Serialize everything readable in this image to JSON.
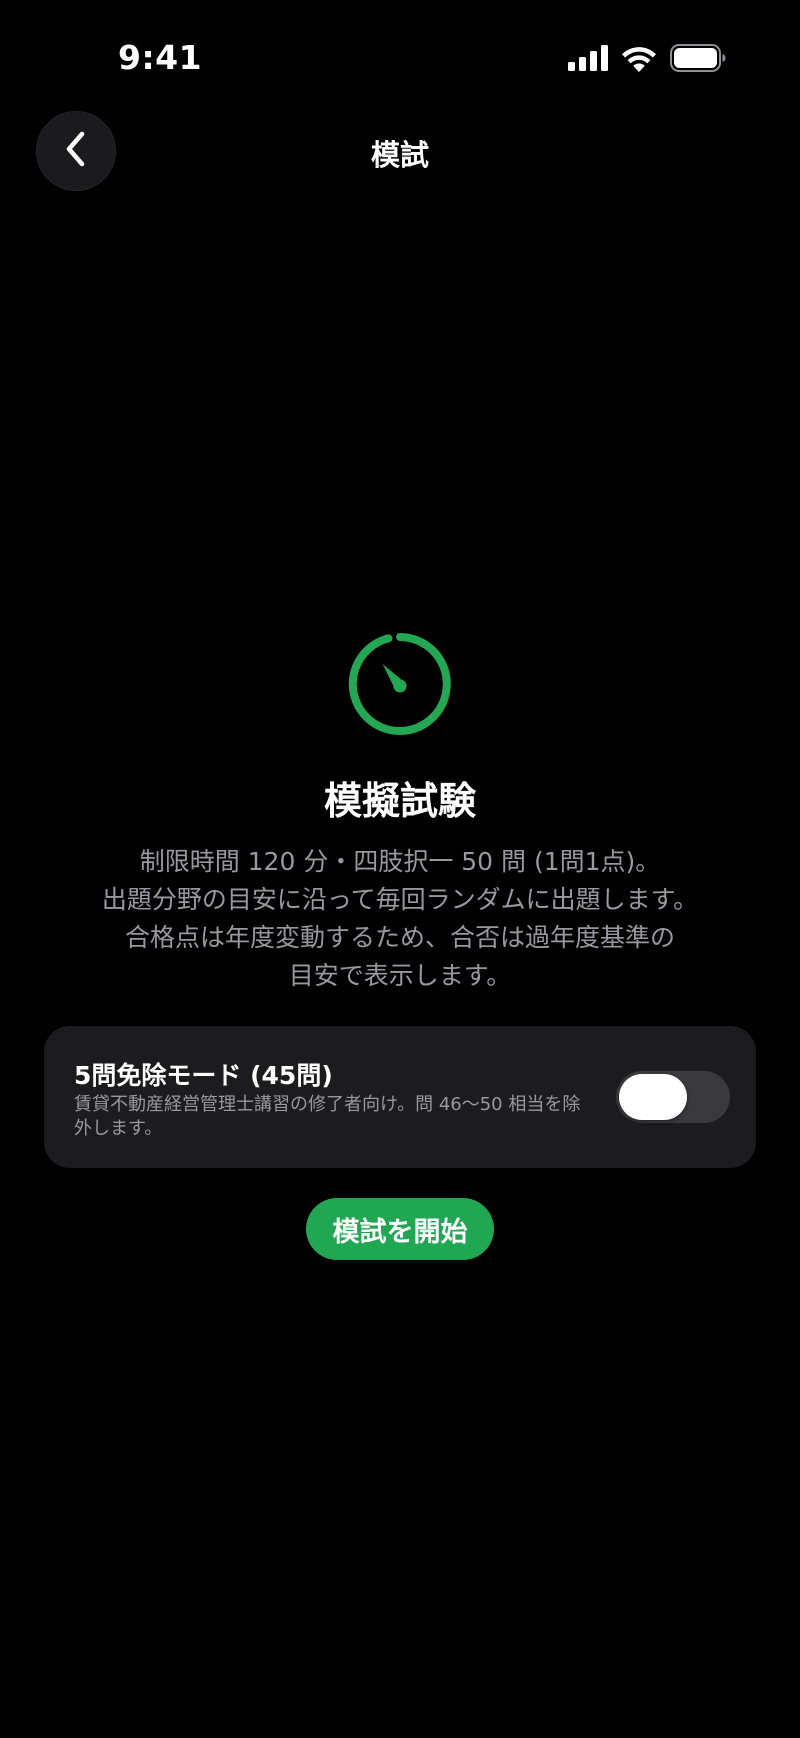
{
  "status_bar": {
    "time": "9:41"
  },
  "nav": {
    "title": "模試",
    "back_icon": "chevron-left-icon"
  },
  "hero": {
    "icon": "timer-icon",
    "icon_color": "#22a853",
    "title": "模擬試験",
    "description_lines": [
      "制限時間 120 分・四肢択一 50 問 (1問1点)。",
      "出題分野の目安に沿って毎回ランダムに出題します。",
      "合格点は年度変動するため、合否は過年度基準の",
      "目安で表示します。"
    ]
  },
  "exemption_option": {
    "title": "5問免除モード (45問)",
    "subtitle": "賃貸不動産経営管理士講習の修了者向け。問 46～50 相当を除外します。",
    "enabled": false
  },
  "actions": {
    "start_label": "模試を開始",
    "accent_color": "#1fa752"
  }
}
